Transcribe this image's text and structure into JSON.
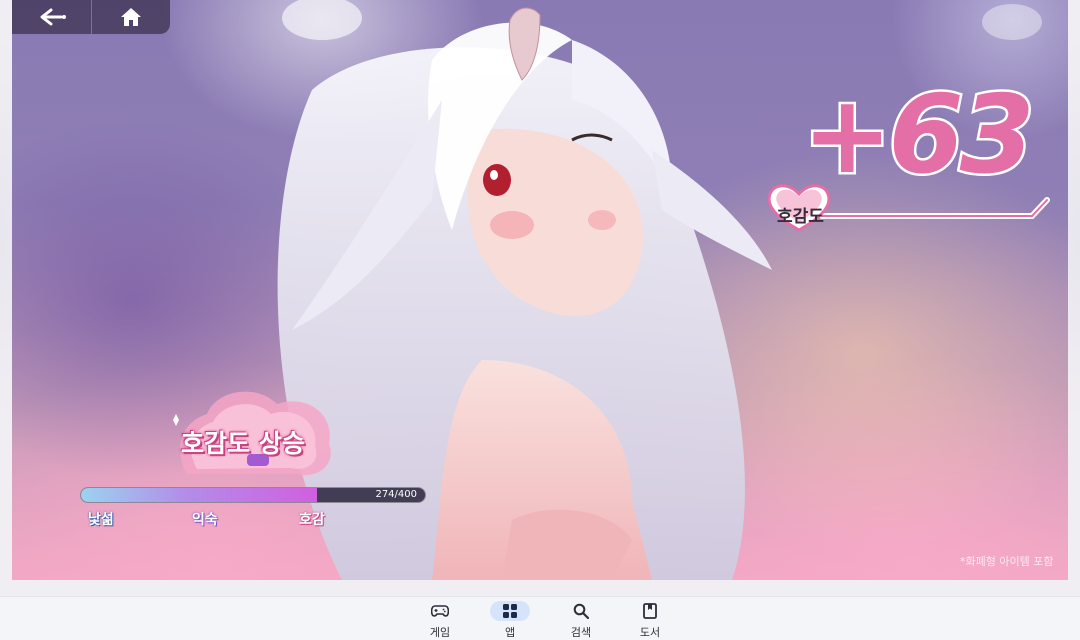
{
  "nav": {
    "back_icon": "back-arrow-icon",
    "home_icon": "home-icon"
  },
  "game": {
    "affinity_gain": "+63",
    "affinity_label": "호감도",
    "banner_text": "호감도 상승",
    "progress": {
      "current": 274,
      "max": 400,
      "text": "274/400"
    },
    "stages": [
      "낯섦",
      "익숙",
      "호감"
    ],
    "disclaimer": "*화폐형 아이템 포함"
  },
  "bottom_tabs": [
    {
      "label": "게임",
      "icon": "gamepad-icon",
      "active": false
    },
    {
      "label": "앱",
      "icon": "apps-grid-icon",
      "active": true
    },
    {
      "label": "검색",
      "icon": "search-icon",
      "active": false
    },
    {
      "label": "도서",
      "icon": "book-icon",
      "active": false
    }
  ],
  "colors": {
    "accent_pink": "#e46ea6",
    "active_tab": "#d6e4fb",
    "progress_fill": "#d15fe0"
  }
}
